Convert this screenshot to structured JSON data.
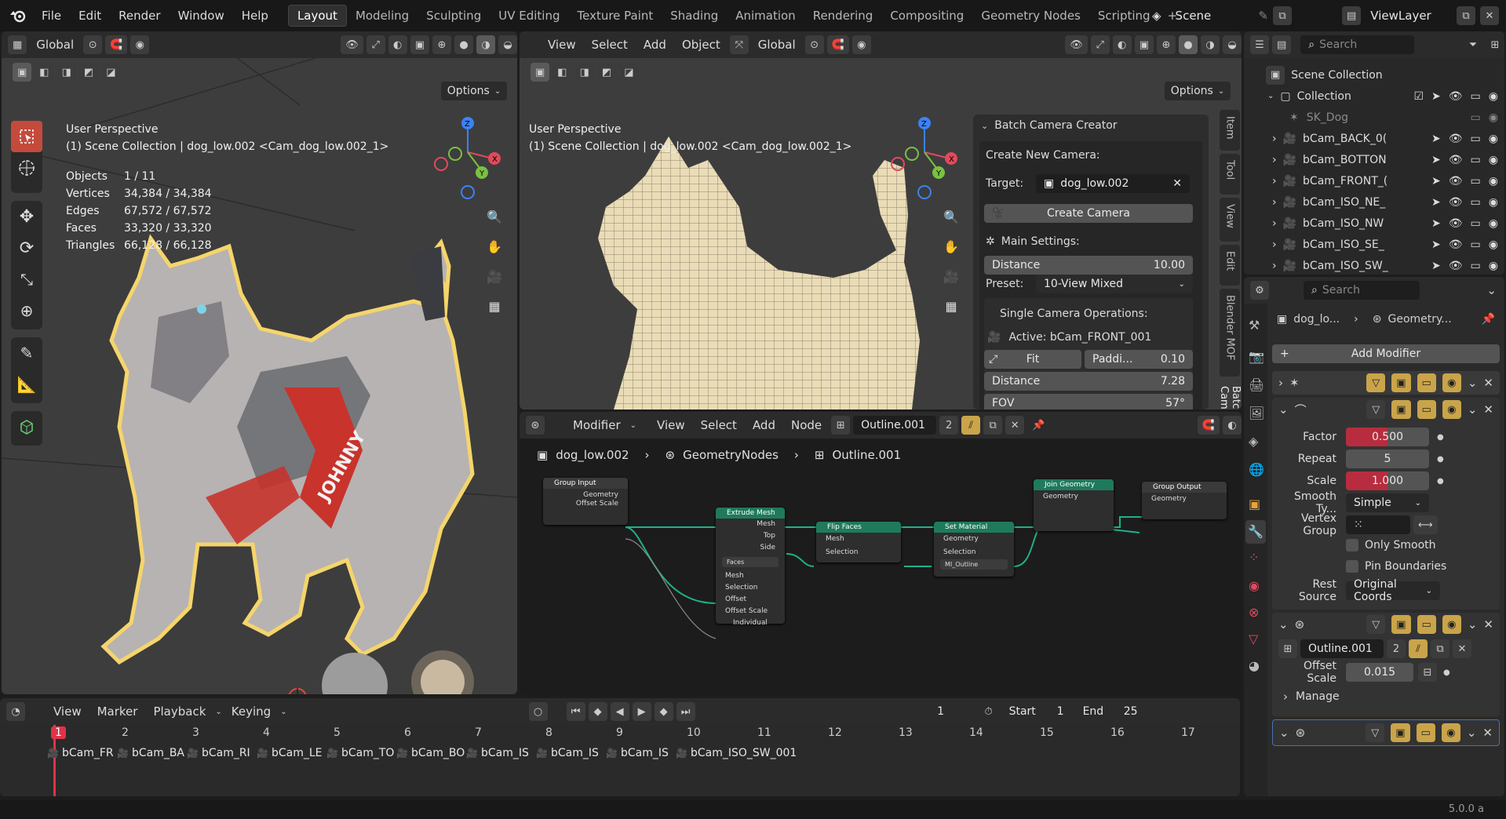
{
  "topbar": {
    "menus": [
      "File",
      "Edit",
      "Render",
      "Window",
      "Help"
    ],
    "workspaces": [
      "Layout",
      "Modeling",
      "Sculpting",
      "UV Editing",
      "Texture Paint",
      "Shading",
      "Animation",
      "Rendering",
      "Compositing",
      "Geometry Nodes",
      "Scripting"
    ],
    "active_workspace": "Layout",
    "add_workspace": "+",
    "scene": "Scene",
    "view_layer": "ViewLayer"
  },
  "viewport_left": {
    "orientation": "Global",
    "options": "Options",
    "perspective": "User Perspective",
    "context": "(1) Scene Collection | dog_low.002 <Cam_dog_low.002_1>",
    "stats": [
      {
        "k": "Objects",
        "v": "1 / 11"
      },
      {
        "k": "Vertices",
        "v": "34,384 / 34,384"
      },
      {
        "k": "Edges",
        "v": "67,572 / 67,572"
      },
      {
        "k": "Faces",
        "v": "33,320 / 33,320"
      },
      {
        "k": "Triangles",
        "v": "66,128 / 66,128"
      }
    ],
    "harness_text": "JOHNNY"
  },
  "viewport_right": {
    "menus": [
      "View",
      "Select",
      "Add",
      "Object"
    ],
    "orientation": "Global",
    "options": "Options",
    "perspective": "User Perspective",
    "context": "(1) Scene Collection | dog_low.002 <Cam_dog_low.002_1>"
  },
  "batch_panel": {
    "title": "Batch Camera Creator",
    "create_new": "Create New Camera:",
    "target_label": "Target:",
    "target_value": "dog_low.002",
    "create_btn": "Create Camera",
    "main_settings": "Main Settings:",
    "distance_label": "Distance",
    "distance_value": "10.00",
    "preset_label": "Preset:",
    "preset_value": "10-View Mixed",
    "single_ops": "Single Camera Operations:",
    "active": "Active: bCam_FRONT_001",
    "fit": "Fit",
    "padding_label": "Paddi...",
    "padding_value": "0.10",
    "distance2_label": "Distance",
    "distance2_value": "7.28",
    "fov_label": "FOV",
    "fov_value": "57°",
    "tabs": [
      "Item",
      "Tool",
      "View",
      "Edit",
      "Blender MOF",
      "Batch Cam"
    ]
  },
  "node_editor": {
    "editor_type": "Modifier",
    "menus": [
      "View",
      "Select",
      "Add",
      "Node"
    ],
    "nodegroup": "Outline.001",
    "users": "2",
    "breadcrumb": [
      "dog_low.002",
      "GeometryNodes",
      "Outline.001"
    ],
    "nodes": {
      "group_input": {
        "title": "Group Input",
        "rows": [
          "Geometry",
          "Offset Scale"
        ]
      },
      "extrude": {
        "title": "Extrude Mesh",
        "outputs": [
          "Mesh",
          "Top",
          "Side"
        ],
        "mode": "Faces",
        "inputs": [
          "Mesh",
          "Selection",
          "Offset",
          "Offset Scale",
          "Individual"
        ]
      },
      "flip": {
        "title": "Flip Faces",
        "rows": [
          "Mesh",
          "Selection"
        ]
      },
      "setmat": {
        "title": "Set Material",
        "rows": [
          "Geometry",
          "Selection"
        ],
        "material": "MI_Outline"
      },
      "join": {
        "title": "Join Geometry",
        "rows": [
          "Geometry"
        ]
      },
      "output": {
        "title": "Group Output",
        "rows": [
          "Geometry"
        ]
      }
    }
  },
  "outliner": {
    "search": "Search",
    "root": "Scene Collection",
    "collection": "Collection",
    "items": [
      "SK_Dog",
      "bCam_BACK_0(",
      "bCam_BOTTON",
      "bCam_FRONT_(",
      "bCam_ISO_NE_",
      "bCam_ISO_NW",
      "bCam_ISO_SE_",
      "bCam_ISO_SW_"
    ]
  },
  "properties": {
    "search": "Search",
    "breadcrumb_obj": "dog_lo...",
    "breadcrumb_mod": "Geometry...",
    "add_modifier": "Add Modifier",
    "factor_label": "Factor",
    "factor_value": "0.500",
    "factor_fill": 0.5,
    "repeat_label": "Repeat",
    "repeat_value": "5",
    "scale_label": "Scale",
    "scale_value": "1.000",
    "scale_fill": 0.5,
    "smooth_label": "Smooth Ty...",
    "smooth_value": "Simple",
    "vgroup_label": "Vertex Group",
    "only_smooth": "Only Smooth",
    "pin_boundaries": "Pin Boundaries",
    "rest_label": "Rest Source",
    "rest_value": "Original Coords",
    "ng_name": "Outline.001",
    "ng_users": "2",
    "offset_label": "Offset Scale",
    "offset_value": "0.015",
    "manage": "Manage"
  },
  "timeline": {
    "menus": [
      "View",
      "Marker",
      "Playback",
      "Keying"
    ],
    "current_frame": "1",
    "start_label": "Start",
    "start": "1",
    "end_label": "End",
    "end": "25",
    "ticks": [
      "1",
      "2",
      "3",
      "4",
      "5",
      "6",
      "7",
      "8",
      "9",
      "10",
      "11",
      "12",
      "13",
      "14",
      "15",
      "16",
      "17"
    ],
    "markers": [
      "bCam_FR",
      "bCam_BA",
      "bCam_RI",
      "bCam_LE",
      "bCam_TO",
      "bCam_BO",
      "bCam_IS",
      "bCam_IS",
      "bCam_IS",
      "bCam_ISO_SW_001"
    ]
  },
  "status": {
    "version": "5.0.0 a"
  },
  "colors": {
    "accent": "#c44a3c",
    "selected_outline": "#f5d56b",
    "node_link": "#20b08a",
    "blue_header": "#4772b3"
  }
}
